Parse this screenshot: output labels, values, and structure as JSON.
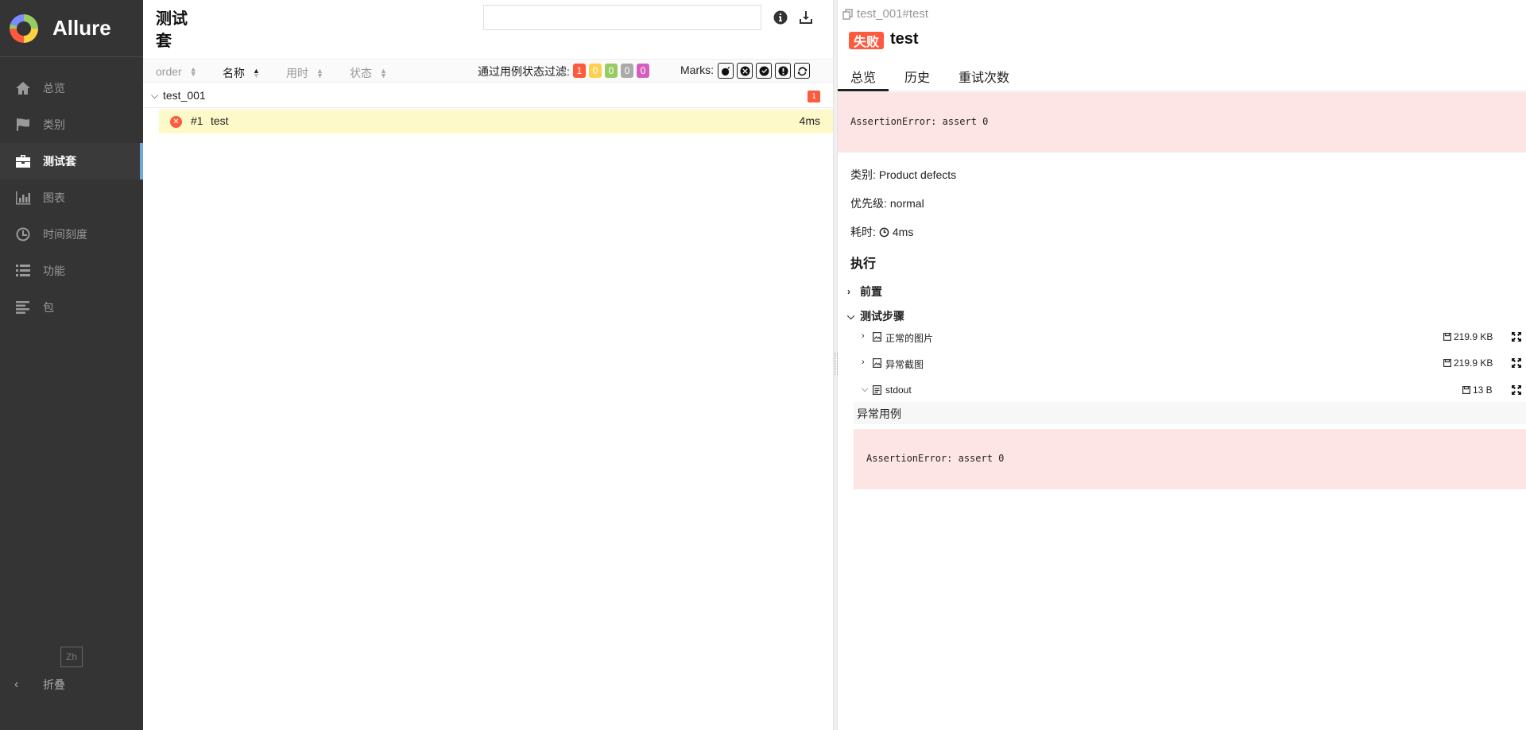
{
  "sidebar": {
    "brand": "Allure",
    "items": [
      {
        "label": "总览",
        "icon": "home-icon"
      },
      {
        "label": "类别",
        "icon": "flag-icon"
      },
      {
        "label": "测试套",
        "icon": "briefcase-icon"
      },
      {
        "label": "图表",
        "icon": "bar-chart-icon"
      },
      {
        "label": "时间刻度",
        "icon": "clock-icon"
      },
      {
        "label": "功能",
        "icon": "list-icon"
      },
      {
        "label": "包",
        "icon": "align-left-icon"
      }
    ],
    "active_index": 2,
    "lang": "Zh",
    "collapse_label": "折叠"
  },
  "suites": {
    "title": "测试套",
    "search": {
      "value": "",
      "placeholder": ""
    },
    "columns": {
      "order": "order",
      "name": "名称",
      "duration": "用时",
      "status": "状态"
    },
    "filter_label": "通过用例状态过滤:",
    "status_counts": [
      {
        "name": "failed",
        "count": "1",
        "color": "#fd5a3e"
      },
      {
        "name": "broken",
        "count": "0",
        "color": "#ffd050"
      },
      {
        "name": "passed",
        "count": "0",
        "color": "#97cc64"
      },
      {
        "name": "skipped",
        "count": "0",
        "color": "#aaaaaa"
      },
      {
        "name": "unknown",
        "count": "0",
        "color": "#d35ebe"
      }
    ],
    "marks_label": "Marks:",
    "groups": [
      {
        "name": "test_001",
        "count": "1",
        "items": [
          {
            "index": "#1",
            "name": "test",
            "duration": "4ms",
            "status": "failed"
          }
        ]
      }
    ]
  },
  "detail": {
    "breadcrumb": "test_001#test",
    "status": "失败",
    "title": "test",
    "tabs": [
      "总览",
      "历史",
      "重试次数"
    ],
    "error": "AssertionError: assert 0",
    "category_label": "类别:",
    "category": "Product defects",
    "severity_label": "优先级:",
    "severity": "normal",
    "duration_label": "耗时:",
    "duration": "4ms",
    "execution_title": "执行",
    "setup_label": "前置",
    "steps_label": "测试步骤",
    "attachments": [
      {
        "name": "正常的图片",
        "size": "219.9 KB",
        "type": "image"
      },
      {
        "name": "异常截图",
        "size": "219.9 KB",
        "type": "image"
      },
      {
        "name": "stdout",
        "size": "13 B",
        "type": "text"
      }
    ],
    "stdout_content": "异常用例",
    "stdout_error": "AssertionError: assert 0"
  },
  "colors": {
    "sidebar_bg": "#343434",
    "failed": "#fd5a3e",
    "selected_row": "#fef9c8",
    "error_bg": "#fee5e5",
    "active_accent": "#6ea8d8"
  }
}
